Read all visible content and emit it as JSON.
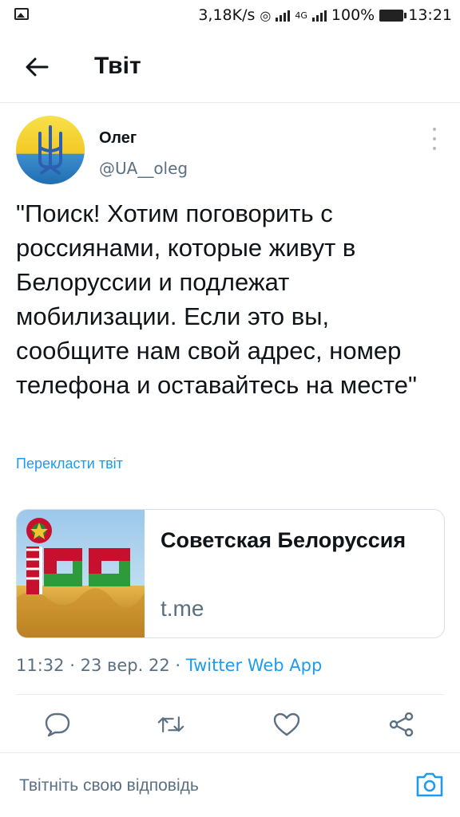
{
  "status_bar": {
    "speed": "3,18K/s",
    "network": "4G",
    "battery": "100%",
    "time": "13:21"
  },
  "header": {
    "title": "Твіт"
  },
  "tweet": {
    "author_name": "Олег",
    "author_handle": "@UA__oleg",
    "text": "\"Поиск! Хотим поговорить с россиянами, которые живут в Белоруссии и подлежат мобилизации. Если это вы, сообщите нам свой адрес, номер телефона и оставайтесь на месте\"",
    "translate_link": "Перекласти твіт",
    "card": {
      "title": "Советская Белоруссия",
      "domain": "t.me"
    },
    "time": "11:32",
    "date": "23 вер. 22",
    "separator": "·",
    "source": "Twitter Web App"
  },
  "actions": {
    "icons": [
      "reply-icon",
      "retweet-icon",
      "like-icon",
      "share-icon"
    ]
  },
  "reply_bar": {
    "placeholder": "Твітніть свою відповідь"
  },
  "colors": {
    "accent": "#1d9bf0",
    "secondary_text": "#5b7083",
    "icon": "#5b7083",
    "border": "#e6ecf0"
  }
}
